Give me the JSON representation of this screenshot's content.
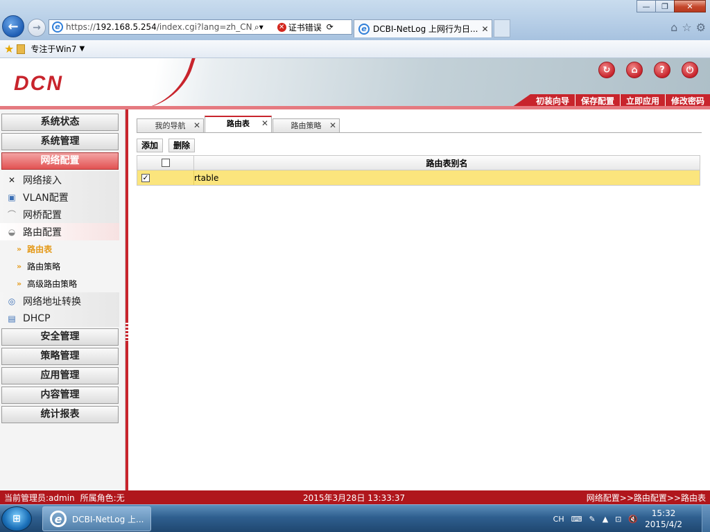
{
  "browser": {
    "url_prefix": "https://",
    "url_host": "192.168.5.254",
    "url_path": "/index.cgi?lang=zh_CN,U",
    "cert_error": "证书错误",
    "tab_title": "DCBI-NetLog 上网行为日...",
    "favorites_item": "专注于Win7"
  },
  "header": {
    "logo": "DCN",
    "top_buttons": [
      "初装向导",
      "保存配置",
      "立即应用",
      "修改密码"
    ]
  },
  "sidebar": {
    "menus_top": [
      "系统状态",
      "系统管理",
      "网络配置"
    ],
    "subs": [
      "网络接入",
      "VLAN配置",
      "网桥配置",
      "路由配置"
    ],
    "leaves": [
      "路由表",
      "路由策略",
      "高级路由策略"
    ],
    "subs_after": [
      "网络地址转换",
      "DHCP"
    ],
    "menus_bottom": [
      "安全管理",
      "策略管理",
      "应用管理",
      "内容管理",
      "统计报表"
    ]
  },
  "content": {
    "tabs": [
      "我的导航",
      "路由表",
      "路由策略"
    ],
    "toolbar": {
      "add": "添加",
      "delete": "删除"
    },
    "table": {
      "column_name": "路由表别名",
      "rows": [
        {
          "name": "rtable",
          "checked": true
        }
      ]
    }
  },
  "status": {
    "admin": "当前管理员:admin",
    "role": "所属角色:无",
    "datetime": "2015年3月28日 13:33:37",
    "breadcrumb": "网络配置>>路由配置>>路由表"
  },
  "taskbar": {
    "item": "DCBI-NetLog 上...",
    "lang": "CH",
    "time": "15:32",
    "date": "2015/4/2"
  },
  "colors": {
    "brand_red": "#c8242c",
    "row_highlight": "#fbe57d"
  }
}
